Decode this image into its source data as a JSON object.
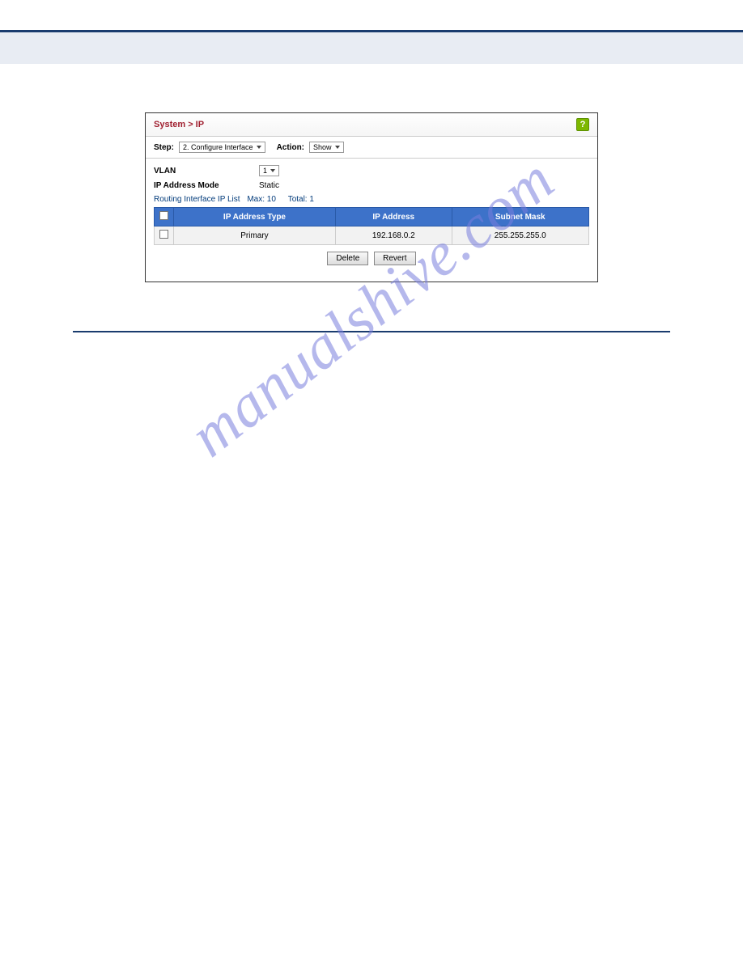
{
  "panel": {
    "breadcrumb": "System > IP",
    "help_tooltip": "?",
    "controls": {
      "step_label": "Step:",
      "step_value": "2. Configure Interface",
      "action_label": "Action:",
      "action_value": "Show"
    },
    "form": {
      "vlan_label": "VLAN",
      "vlan_value": "1",
      "mode_label": "IP Address Mode",
      "mode_value": "Static"
    },
    "list": {
      "title": "Routing Interface IP List",
      "max_label": "Max: 10",
      "total_label": "Total: 1",
      "columns": {
        "type": "IP Address Type",
        "address": "IP Address",
        "mask": "Subnet Mask"
      },
      "rows": [
        {
          "type": "Primary",
          "address": "192.168.0.2",
          "mask": "255.255.255.0"
        }
      ]
    },
    "buttons": {
      "delete": "Delete",
      "revert": "Revert"
    }
  },
  "watermark": "manualshive.com"
}
